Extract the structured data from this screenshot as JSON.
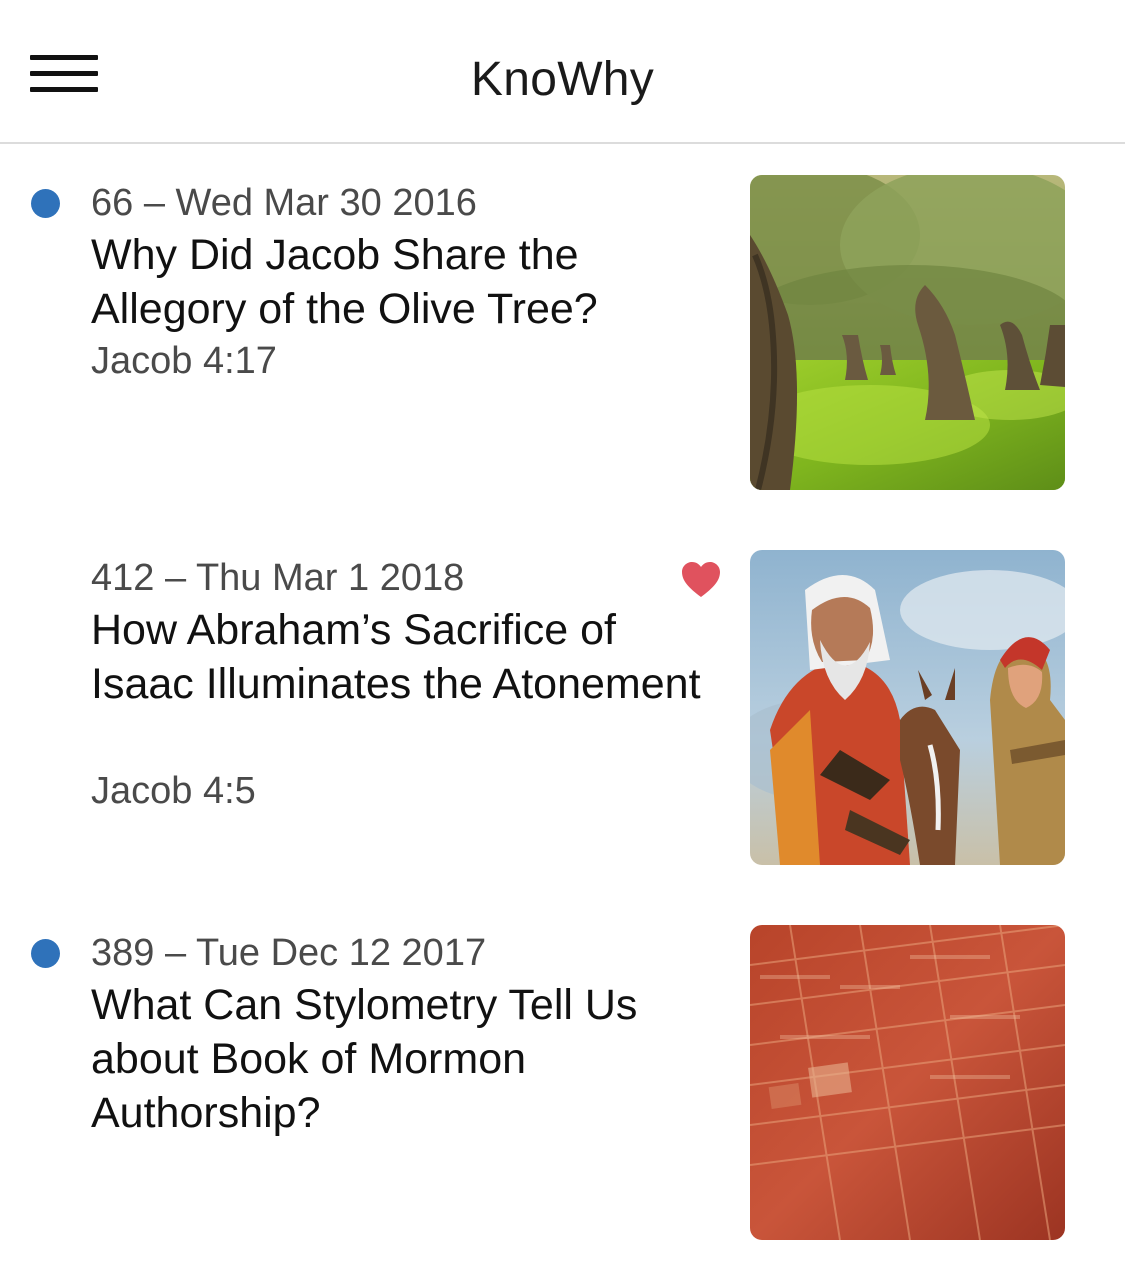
{
  "app": {
    "title": "KnoWhy"
  },
  "icons": {
    "menu": "hamburger-menu-icon",
    "unread": "unread-dot-icon",
    "favorite": "heart-icon"
  },
  "colors": {
    "unread_dot": "#2f72ba",
    "favorite_heart": "#e0525e",
    "meta_text": "#4a4a4a"
  },
  "items": [
    {
      "meta": "66 – Wed Mar 30 2016",
      "title": "Why Did Jacob Share the Allegory of the Olive Tree?",
      "reference": "Jacob 4:17",
      "unread": true,
      "favorite": false,
      "image": "olive grove with gnarled trees on green grass"
    },
    {
      "meta": "412 – Thu Mar 1 2018",
      "title": "How Abraham’s Sacrifice of Isaac Illuminates the Atonement",
      "reference": "Jacob 4:5",
      "unread": false,
      "favorite": true,
      "image": "painting of Abraham with a donkey and young Isaac"
    },
    {
      "meta": "389 – Tue Dec 12 2017",
      "title": "What Can Stylometry Tell Us about Book of Mormon Authorship?",
      "reference": "",
      "unread": true,
      "favorite": false,
      "image": "red tinted close-up of printed text"
    }
  ]
}
